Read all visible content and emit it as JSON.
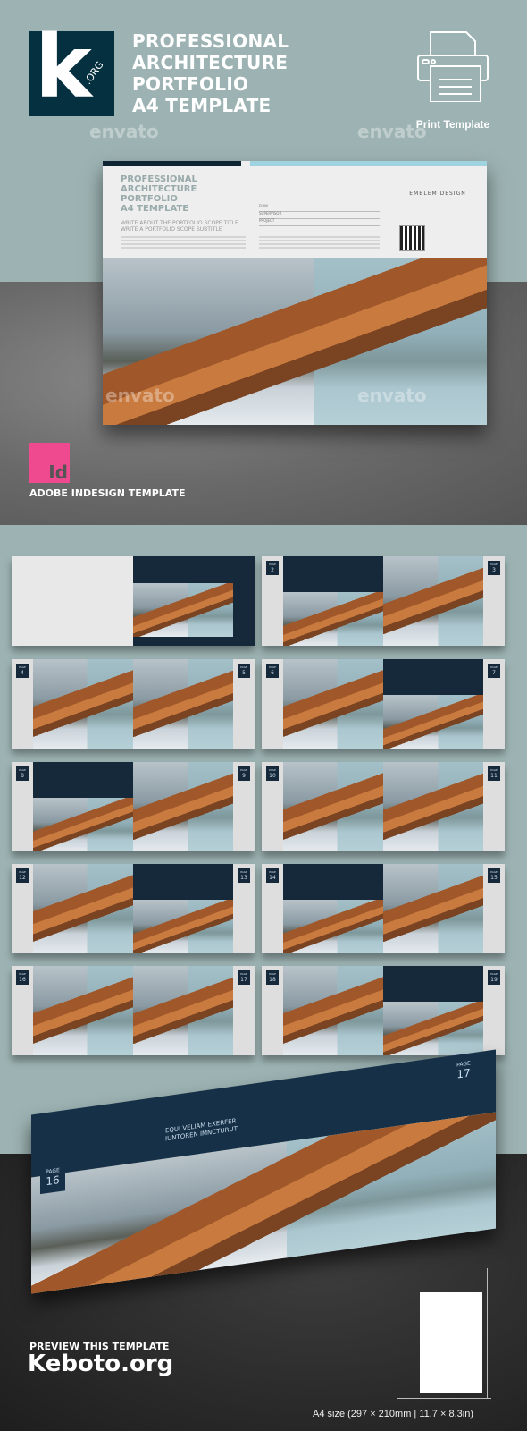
{
  "header": {
    "logo_text": "k",
    "logo_suffix": ".ORG",
    "title_lines": [
      "PROFESSIONAL",
      "ARCHITECTURE",
      "PORTFOLIO",
      "A4 TEMPLATE"
    ],
    "print_label": "Print Template",
    "print_icon": "printer-icon"
  },
  "watermark": "envato",
  "hero": {
    "title_lines": [
      "PROFESSIONAL",
      "ARCHITECTURE",
      "PORTFOLIO",
      "A4 TEMPLATE"
    ],
    "scope_title": "WRITE ABOUT THE PORTFOLIO SCOPE TITLE",
    "scope_subtitle": "WRITE A PORTFOLIO SCOPE SUBTITLE",
    "fields": [
      "FIRM",
      "SUPERVISOR",
      "PROJECT"
    ],
    "emblem": "EMBLEM DESIGN"
  },
  "indesign": {
    "icon_text": "Id",
    "label": "ADOBE INDESIGN TEMPLATE"
  },
  "page_label": "PAGE",
  "thumbnails": [
    {
      "left": null,
      "right": null
    },
    {
      "left": "2",
      "right": "3"
    },
    {
      "left": "4",
      "right": "5"
    },
    {
      "left": "6",
      "right": "7"
    },
    {
      "left": "8",
      "right": "9"
    },
    {
      "left": "10",
      "right": "11"
    },
    {
      "left": "12",
      "right": "13"
    },
    {
      "left": "14",
      "right": "15"
    },
    {
      "left": "16",
      "right": "17"
    },
    {
      "left": "18",
      "right": "19"
    }
  ],
  "bottom_book": {
    "left_page": "16",
    "right_page": "17",
    "heading": [
      "EQUI VELIAM EXERFER",
      "IUNTOREN IMNCTURUT"
    ]
  },
  "footer": {
    "preview_label": "PREVIEW THIS TEMPLATE",
    "site": "Keboto.org",
    "size_label": "A4 size (297 × 210mm | 11.7 × 8.3in)"
  },
  "colors": {
    "teal_bg": "#9db3b3",
    "navy": "#04303f",
    "indesign_pink": "#ef4a8f",
    "accent_blue": "#9fd3df"
  }
}
